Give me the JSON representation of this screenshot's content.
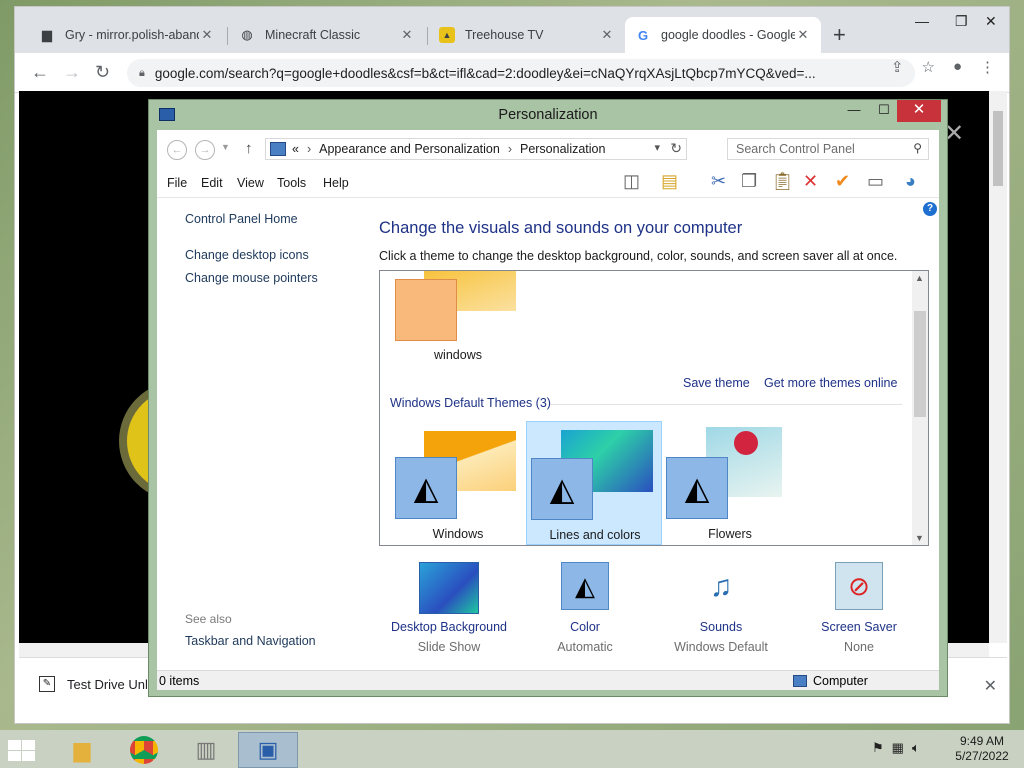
{
  "browser": {
    "tabs": [
      {
        "title": "Gry - mirror.polish-aband",
        "icon": "folder-icon"
      },
      {
        "title": "Minecraft Classic",
        "icon": "globe-icon"
      },
      {
        "title": "Treehouse TV",
        "icon": "treehouse-icon"
      },
      {
        "title": "google doodles - Google",
        "icon": "google-icon"
      }
    ],
    "new_tab_label": "+",
    "url": "google.com/search?q=google+doodles&csf=b&ct=ifl&cad=2:doodley&ei=cNaQYrqXAsjLtQbcp7mYCQ&ved=...",
    "download": {
      "name": "Test Drive Unli",
      "close": "✕"
    }
  },
  "cp": {
    "title": "Personalization",
    "breadcrumb": [
      "«",
      "Appearance and Personalization",
      "Personalization"
    ],
    "search_placeholder": "Search Control Panel",
    "menu": [
      "File",
      "Edit",
      "View",
      "Tools",
      "Help"
    ],
    "left_links": [
      "Control Panel Home",
      "Change desktop icons",
      "Change mouse pointers"
    ],
    "see_also": "See also",
    "see_also_links": [
      "Taskbar and Navigation"
    ],
    "heading": "Change the visuals and sounds on your computer",
    "subheading": "Click a theme to change the desktop background, color, sounds, and screen saver all at once.",
    "my_theme": "windows",
    "save_theme": "Save theme",
    "get_more": "Get more themes online",
    "group_heading": "Windows Default Themes (3)",
    "themes": [
      {
        "name": "Windows",
        "selected": false
      },
      {
        "name": "Lines and colors",
        "selected": true
      },
      {
        "name": "Flowers",
        "selected": false
      }
    ],
    "bottom": [
      {
        "label": "Desktop Background",
        "value": "Slide Show",
        "icon": "desktop-background-icon"
      },
      {
        "label": "Color",
        "value": "Automatic",
        "icon": "color-icon"
      },
      {
        "label": "Sounds",
        "value": "Windows Default",
        "icon": "sounds-icon"
      },
      {
        "label": "Screen Saver",
        "value": "None",
        "icon": "screen-saver-icon"
      }
    ],
    "status_items": "0 items",
    "status_location": "Computer"
  },
  "taskbar": {
    "time": "9:49 AM",
    "date": "5/27/2022"
  }
}
